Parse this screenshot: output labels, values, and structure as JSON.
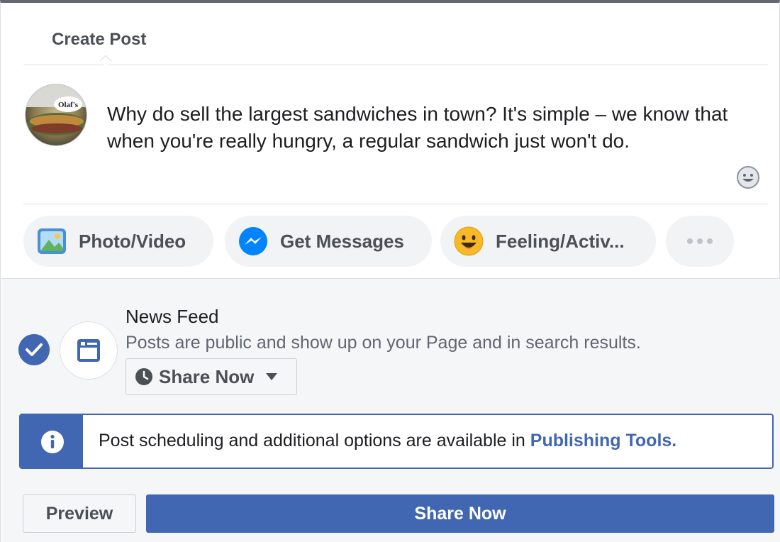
{
  "header": {
    "title": "Create Post"
  },
  "composer": {
    "avatar_text": "Olaf's",
    "text": "Why do sell the largest sandwiches in town? It's simple – we know that when you're really hungry, a regular sandwich just won't do.",
    "emoji_icon": "smiley-icon"
  },
  "actions": [
    {
      "label": "Photo/Video",
      "icon": "photo-video-icon"
    },
    {
      "label": "Get Messages",
      "icon": "messenger-icon"
    },
    {
      "label": "Feeling/Activ...",
      "icon": "feeling-emoji-icon"
    },
    {
      "label": "",
      "icon": "more-dots-icon"
    }
  ],
  "news_feed": {
    "checked": true,
    "title": "News Feed",
    "description": "Posts are public and show up on your Page and in search results.",
    "dropdown_label": "Share Now"
  },
  "info": {
    "text": "Post scheduling and additional options are available in ",
    "link": "Publishing Tools."
  },
  "footer": {
    "preview_label": "Preview",
    "share_label": "Share Now"
  },
  "colors": {
    "brand": "#4267b2",
    "pill_bg": "#f2f3f5",
    "section_bg": "#f5f6f7"
  }
}
